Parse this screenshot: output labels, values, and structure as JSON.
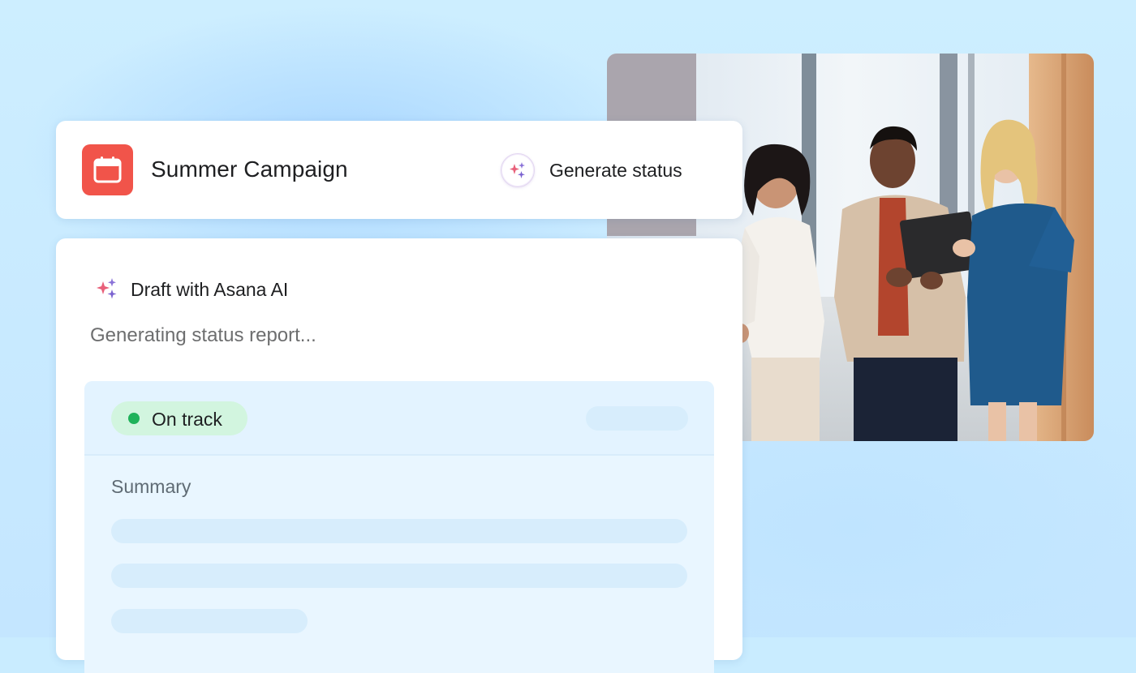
{
  "header": {
    "project_icon": "calendar-icon",
    "project_title": "Summer Campaign",
    "generate_button": {
      "icon": "sparkle-icon",
      "label": "Generate status"
    }
  },
  "draft": {
    "icon": "sparkle-icon",
    "label": "Draft with Asana AI",
    "status_text": "Generating status report..."
  },
  "report": {
    "status_badge": {
      "label": "On track",
      "color": "#1fb25a"
    },
    "summary_label": "Summary"
  },
  "colors": {
    "brand_coral": "#f1544a",
    "background": "#c9ecff",
    "on_track_bg": "#d2f5df"
  }
}
